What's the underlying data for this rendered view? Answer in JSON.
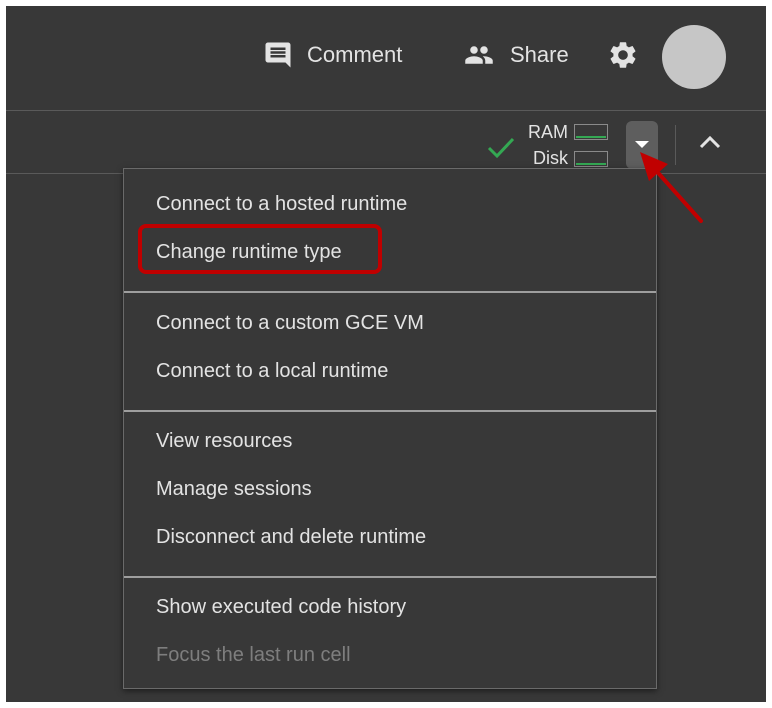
{
  "header": {
    "comment_label": "Comment",
    "share_label": "Share"
  },
  "toolbar": {
    "ram_label": "RAM",
    "disk_label": "Disk",
    "status_color": "#34a853"
  },
  "runtime_menu": {
    "groups": [
      [
        "Connect to a hosted runtime",
        "Change runtime type"
      ],
      [
        "Connect to a custom GCE VM",
        "Connect to a local runtime"
      ],
      [
        "View resources",
        "Manage sessions",
        "Disconnect and delete runtime"
      ],
      [
        "Show executed code history",
        "Focus the last run cell"
      ]
    ],
    "disabled_item": "Focus the last run cell",
    "highlighted_item": "Change runtime type"
  },
  "annotation": {
    "highlight_color": "#c00000",
    "arrow_color": "#c00000"
  },
  "icons": [
    "comment-icon",
    "share-icon",
    "gear-icon",
    "checkmark-icon",
    "caret-down-icon",
    "chevron-up-icon"
  ]
}
